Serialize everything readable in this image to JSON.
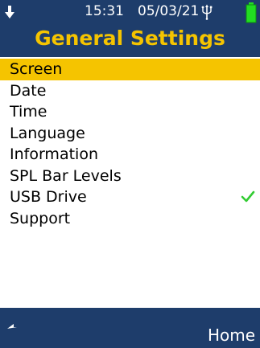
{
  "status_bar": {
    "time": "15:31",
    "date": "05/03/21",
    "download_icon": "download-arrow-icon",
    "usb_icon": "usb-icon",
    "battery_icon": "battery-full-icon"
  },
  "header": {
    "title": "General Settings"
  },
  "menu": {
    "items": [
      {
        "label": "Screen",
        "selected": true,
        "checked": false
      },
      {
        "label": "Date",
        "selected": false,
        "checked": false
      },
      {
        "label": "Time",
        "selected": false,
        "checked": false
      },
      {
        "label": "Language",
        "selected": false,
        "checked": false
      },
      {
        "label": "Information",
        "selected": false,
        "checked": false
      },
      {
        "label": "SPL Bar Levels",
        "selected": false,
        "checked": false
      },
      {
        "label": "USB Drive",
        "selected": false,
        "checked": true
      },
      {
        "label": "Support",
        "selected": false,
        "checked": false
      }
    ]
  },
  "footer": {
    "back_icon": "back-arrow-icon",
    "home_label": "Home"
  },
  "colors": {
    "header_bg": "#1e3d6b",
    "accent": "#f5c400",
    "check": "#33cc33",
    "battery": "#22dd22"
  }
}
